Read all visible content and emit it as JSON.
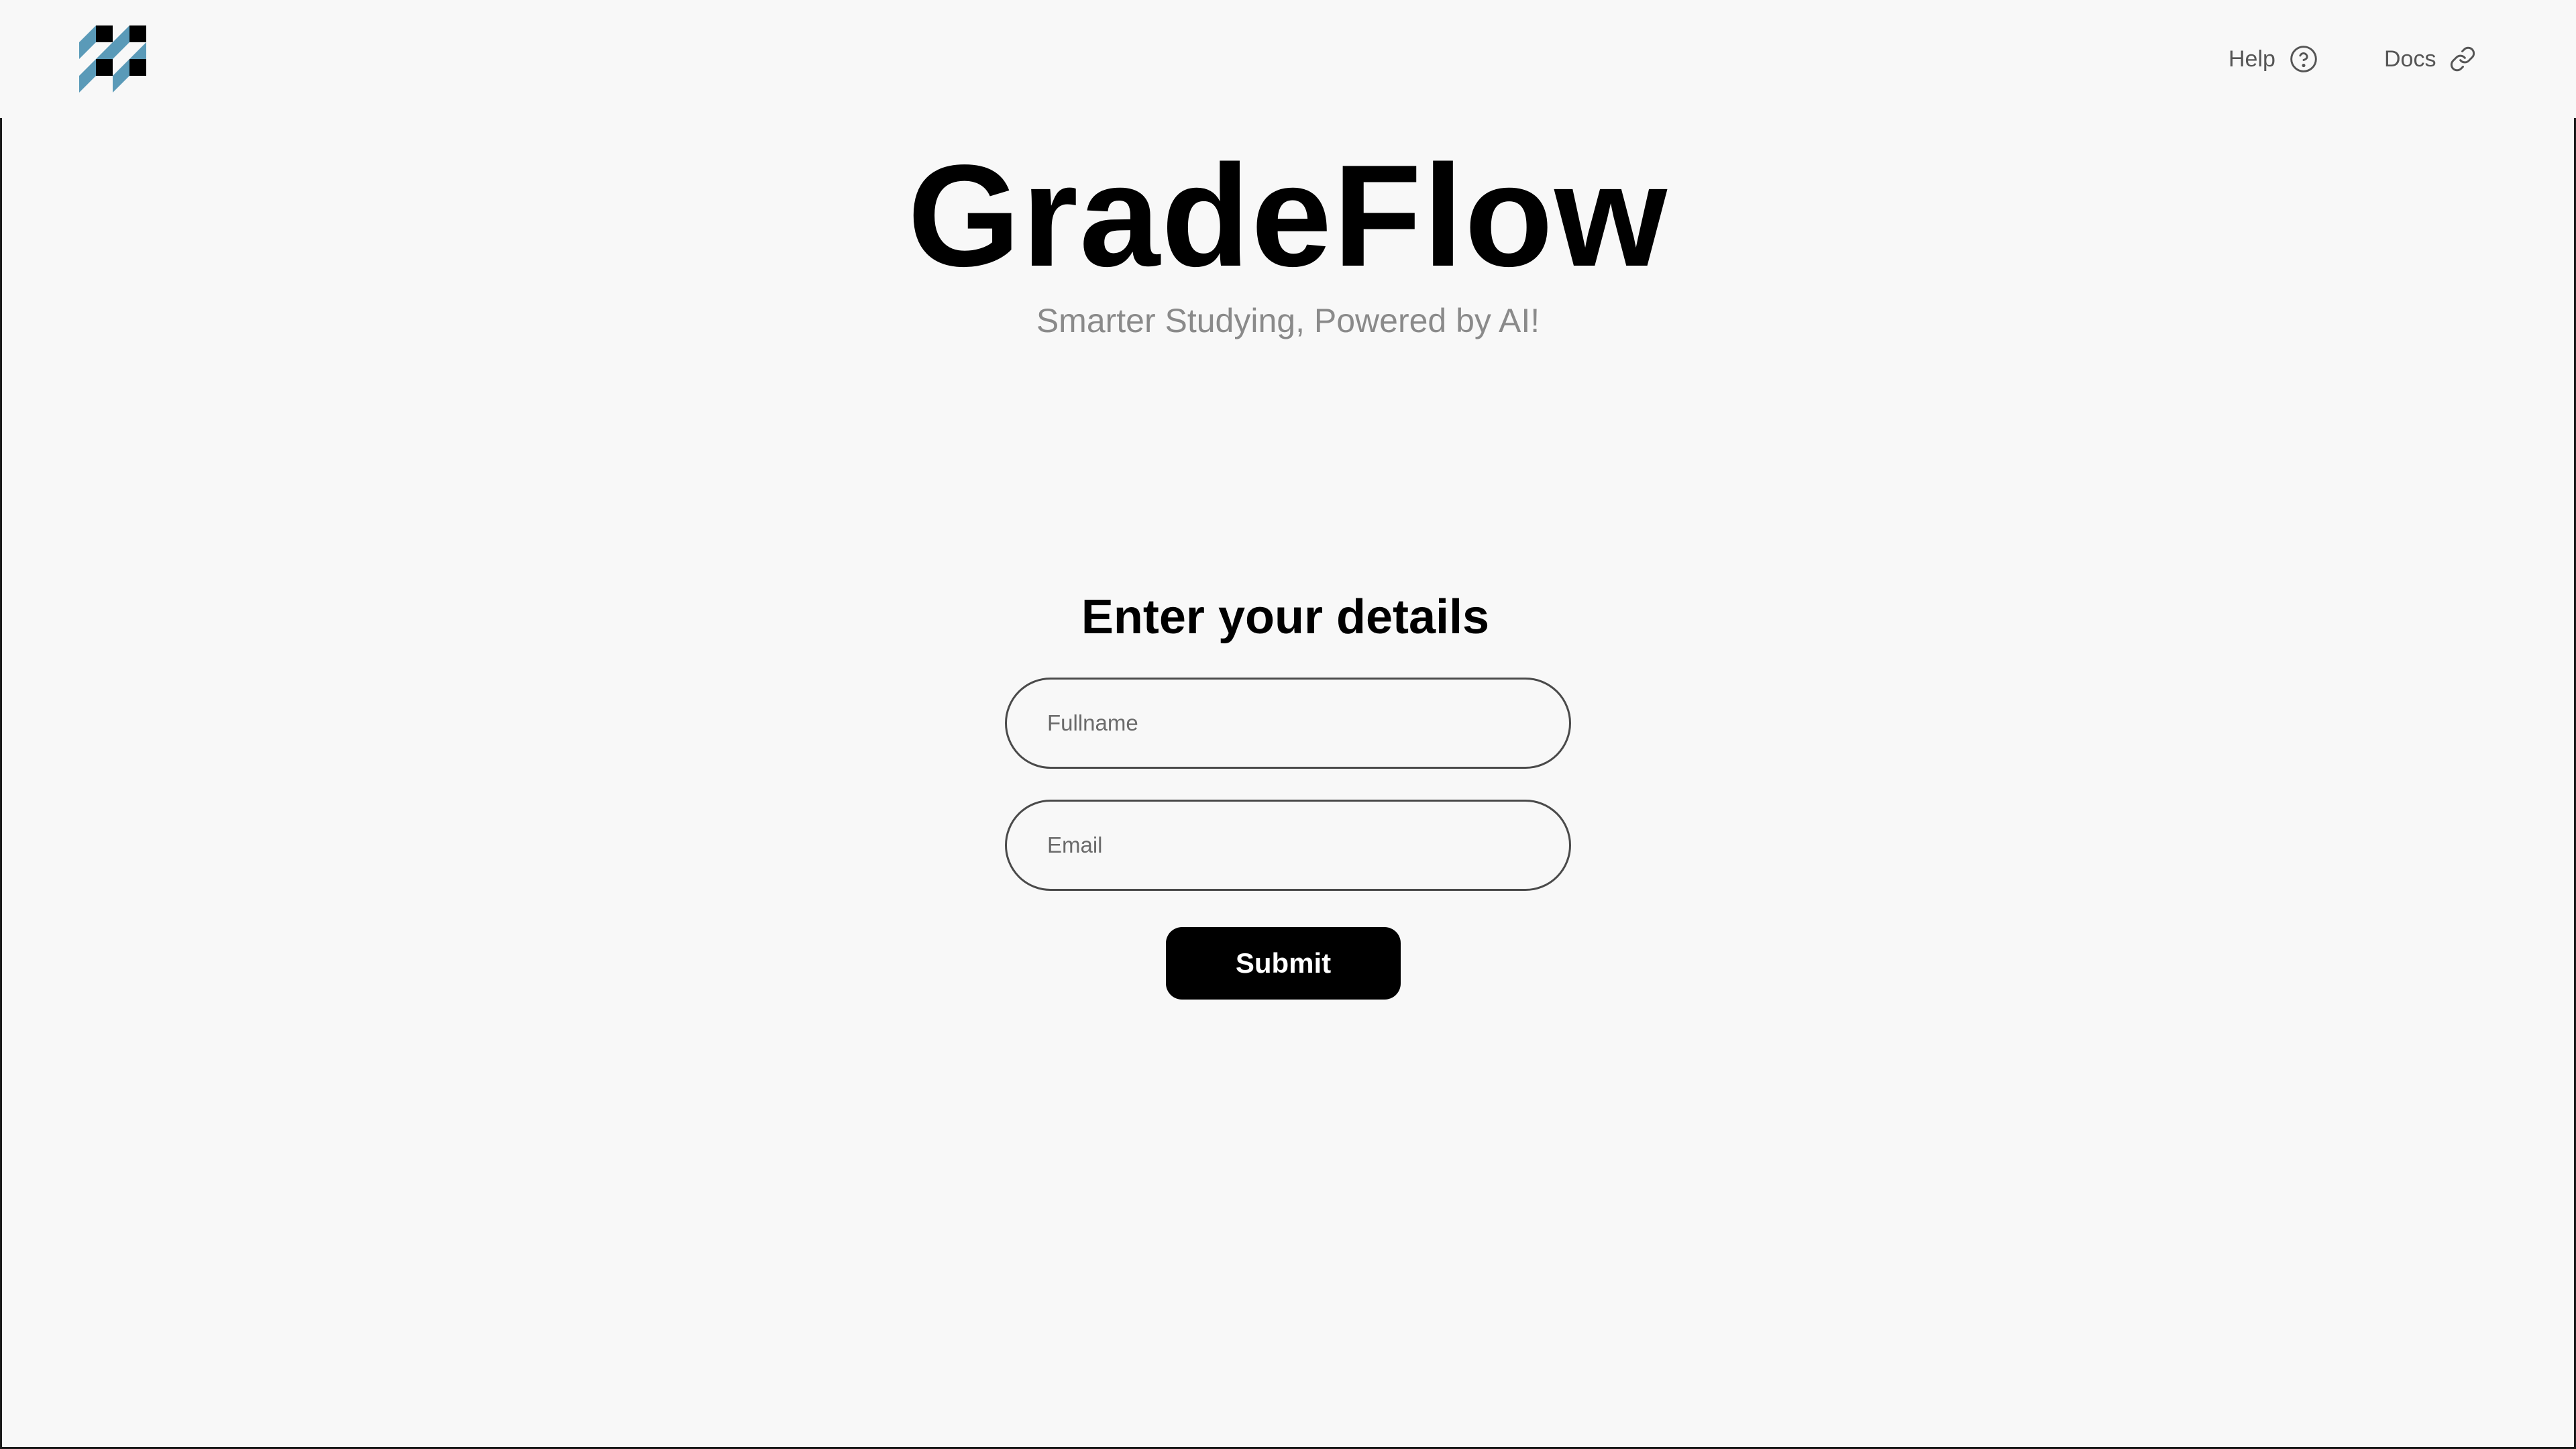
{
  "brand": {
    "logo_icon": "checkered-blocks-logo-icon",
    "accent_color": "#5a9ab8",
    "dark_color": "#000000"
  },
  "nav": {
    "help_label": "Help",
    "help_icon": "question-circle-icon",
    "docs_label": "Docs",
    "docs_icon": "link-icon"
  },
  "hero": {
    "title": "GradeFlow",
    "subtitle": "Smarter Studying, Powered by AI!"
  },
  "form": {
    "title": "Enter your details",
    "fullname_placeholder": "Fullname",
    "fullname_value": "",
    "email_placeholder": "Email",
    "email_value": "",
    "submit_label": "Submit"
  }
}
